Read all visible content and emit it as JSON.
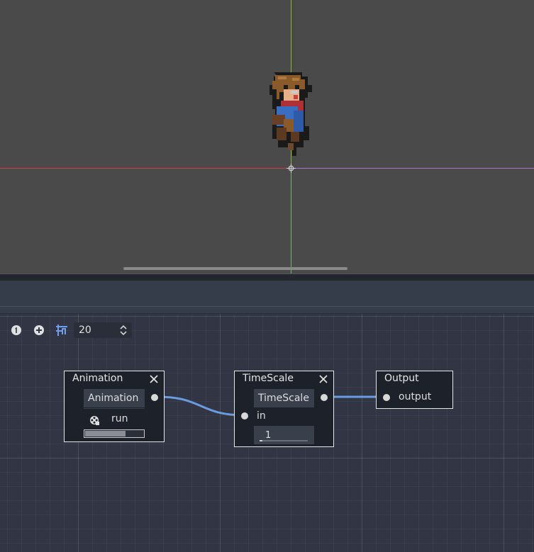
{
  "toolbar": {
    "snap_value": "20"
  },
  "nodes": {
    "animation": {
      "title": "Animation",
      "chip": "Animation",
      "anim_name": "run",
      "progress": 0.7
    },
    "timescale": {
      "title": "TimeScale",
      "chip": "TimeScale",
      "input_label": "in",
      "scale_value": "1"
    },
    "output": {
      "title": "Output",
      "port_label": "output"
    }
  },
  "colors": {
    "wire": "#6a9ce0",
    "axis_x": "#c8404a",
    "axis_y": "#8fb33a",
    "graph_bg": "#323644",
    "viewport_bg": "#4a4a4a"
  }
}
